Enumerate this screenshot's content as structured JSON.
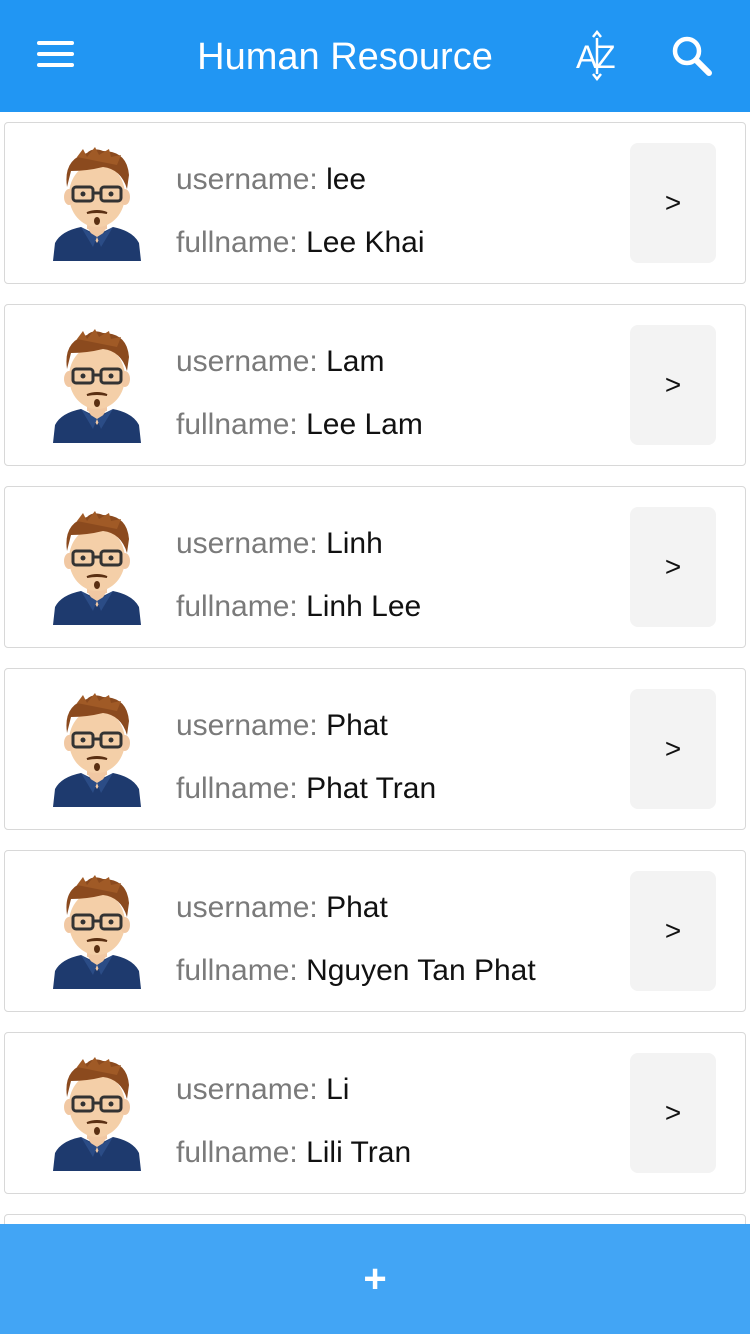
{
  "header": {
    "title": "Human Resource",
    "menu_icon": "hamburger-menu-icon",
    "sort_icon": "sort-az-icon",
    "search_icon": "search-icon",
    "background_color": "#2196f3"
  },
  "list_labels": {
    "username": "username: ",
    "fullname": "fullname: "
  },
  "users": [
    {
      "username": "lee",
      "fullname": "Lee Khai",
      "action": ">"
    },
    {
      "username": "Lam",
      "fullname": "Lee Lam",
      "action": ">"
    },
    {
      "username": "Linh",
      "fullname": "Linh Lee",
      "action": ">"
    },
    {
      "username": "Phat",
      "fullname": "Phat Tran",
      "action": ">"
    },
    {
      "username": "Phat",
      "fullname": "Nguyen Tan Phat",
      "action": ">"
    },
    {
      "username": "Li",
      "fullname": "Lili Tran",
      "action": ">"
    }
  ],
  "footer": {
    "add_label": "+",
    "background_color": "#42a5f5"
  }
}
